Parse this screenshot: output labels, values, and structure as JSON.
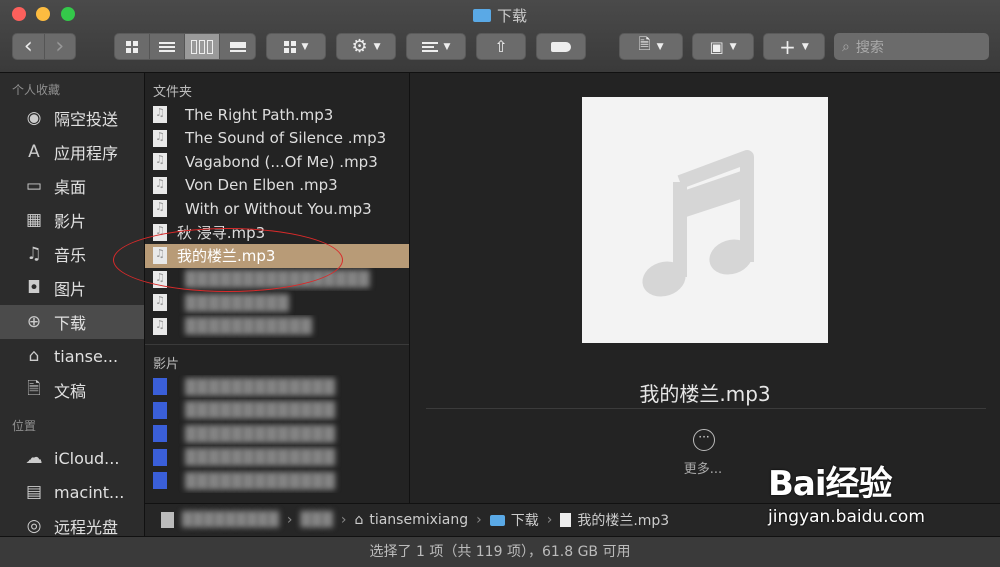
{
  "window": {
    "title": "下载"
  },
  "toolbar": {
    "back": "‹",
    "forward": "›",
    "search_placeholder": "搜索",
    "add_label": "+"
  },
  "sidebar": {
    "favorites_header": "个人收藏",
    "favorites": [
      {
        "label": "隔空投送",
        "icon": "airdrop-icon"
      },
      {
        "label": "应用程序",
        "icon": "applications-icon"
      },
      {
        "label": "桌面",
        "icon": "desktop-icon"
      },
      {
        "label": "影片",
        "icon": "movies-icon"
      },
      {
        "label": "音乐",
        "icon": "music-icon"
      },
      {
        "label": "图片",
        "icon": "pictures-icon"
      },
      {
        "label": "下载",
        "icon": "downloads-icon",
        "selected": true
      },
      {
        "label": "tianse...",
        "icon": "home-icon"
      },
      {
        "label": "文稿",
        "icon": "documents-icon"
      }
    ],
    "locations_header": "位置",
    "locations": [
      {
        "label": "iCloud...",
        "icon": "icloud-icon"
      },
      {
        "label": "macint...",
        "icon": "disk-icon"
      },
      {
        "label": "远程光盘",
        "icon": "optical-disc-icon"
      }
    ]
  },
  "column": {
    "folder_section": "文件夹",
    "files": [
      {
        "name": "The Right Path.mp3"
      },
      {
        "name": "The Sound of Silence  .mp3"
      },
      {
        "name": "Vagabond (...Of Me)  .mp3"
      },
      {
        "name": "Von Den Elben  .mp3"
      },
      {
        "name": "With or Without You.mp3"
      },
      {
        "name": "秋 浸寻.mp3"
      },
      {
        "name": "我的楼兰.mp3",
        "selected": true
      }
    ],
    "movies_section": "影片"
  },
  "preview": {
    "filename": "我的楼兰.mp3",
    "more_label": "更多..."
  },
  "pathbar": {
    "folder": "下载",
    "file": "我的楼兰.mp3",
    "user_partial": "tiansemixiang"
  },
  "status": {
    "text": "选择了 1 项（共 119 项），61.8 GB 可用"
  },
  "watermark": {
    "logo": "Bai经验",
    "url": "jingyan.baidu.com"
  },
  "colors": {
    "selection": "#b89b77",
    "annotation": "#d92a2a",
    "folder_blue": "#5aa9e6"
  }
}
